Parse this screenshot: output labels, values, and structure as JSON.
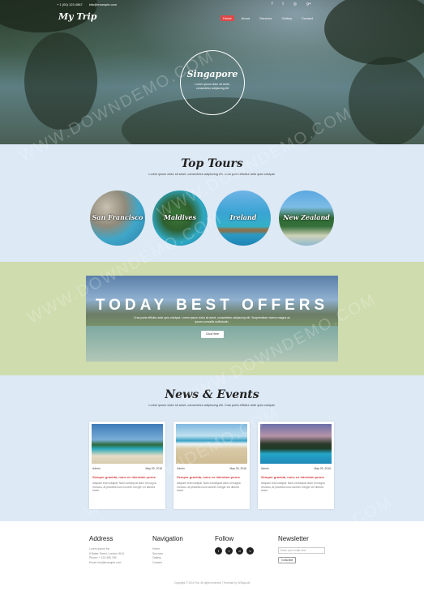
{
  "header": {
    "phone": "+ 1 (00) 123 4567",
    "email": "info@example.com",
    "logo": "My Trip",
    "social_icons": [
      "facebook-icon",
      "twitter-icon",
      "instagram-icon",
      "google-plus-icon"
    ],
    "social_glyphs": [
      "f",
      "t",
      "◎",
      "g+"
    ],
    "nav": [
      "Home",
      "About",
      "Services",
      "Gallery",
      "Contact"
    ],
    "nav_active": "Home"
  },
  "hero": {
    "city": "Singapore",
    "subtitle": "Lorem ipsum dolor sit amet, consectetur adipiscing elit"
  },
  "tours": {
    "title": "Top Tours",
    "tagline": "Lorem ipsum dolor sit amet, consectetur adipiscing elit. Cras porta efficitur ante quis volutpat.",
    "items": [
      {
        "label": "San Francisco"
      },
      {
        "label": "Maldives"
      },
      {
        "label": "Ireland"
      },
      {
        "label": "New Zealand"
      }
    ]
  },
  "offers": {
    "title": "TODAY BEST OFFERS",
    "description": "Cras porta efficitur ante quis volutpat. Lorem ipsum dolor sit amet, consectetur adipiscing elit. Suspendisse viverra magna ac ipsum convallis sollicitudin.",
    "button": "Click Here"
  },
  "news": {
    "title": "News & Events",
    "tagline": "Lorem ipsum dolor sit amet, consectetur adipiscing elit. Cras porta efficitur ante quis volutpat.",
    "cards": [
      {
        "author": "Admin",
        "date": "May 09, 2016",
        "title": "Semper gravida, nunc ex interdum purus",
        "body": "Aliquam erat volutpat. Nam consequat dolor id magna rhoncus, at pharetra nunc laoreet. Integer vel ultrices lorem."
      },
      {
        "author": "Admin",
        "date": "May 09, 2016",
        "title": "Semper gravida, nunc ex interdum purus",
        "body": "Aliquam erat volutpat. Nam consequat dolor id magna rhoncus, at pharetra nunc laoreet. Integer vel ultrices lorem."
      },
      {
        "author": "Admin",
        "date": "May 09, 2016",
        "title": "Semper gravida, nunc ex interdum purus",
        "body": "Aliquam erat volutpat. Nam consequat dolor id magna rhoncus, at pharetra nunc laoreet. Integer vel ultrices lorem."
      }
    ]
  },
  "footer": {
    "address_title": "Address",
    "address_lines": [
      "Lorem Ipsum Inc",
      "8 Baker Street, London W1U",
      "Phone: + 123 456 789",
      "Email: info@example.com"
    ],
    "navigation_title": "Navigation",
    "navigation_links": [
      "Home",
      "Services",
      "Gallery",
      "Contact"
    ],
    "follow_title": "Follow",
    "follow_icons": [
      "facebook-icon",
      "twitter-icon",
      "dribbble-icon",
      "vimeo-icon"
    ],
    "follow_glyphs": [
      "f",
      "t",
      "d",
      "v"
    ],
    "newsletter_title": "Newsletter",
    "newsletter_placeholder": "Enter your email here",
    "newsletter_button": "Subscribe",
    "copyright": "Copyright © 2016 Trip. All rights reserved | Template by W3layouts"
  },
  "watermark": "WWW.DOWNDEMO.COM",
  "colors": {
    "accent": "#e04848",
    "tours_bg": "#dde9f5",
    "offers_bg": "#cfdcae",
    "news_title": "#d63e3e"
  }
}
